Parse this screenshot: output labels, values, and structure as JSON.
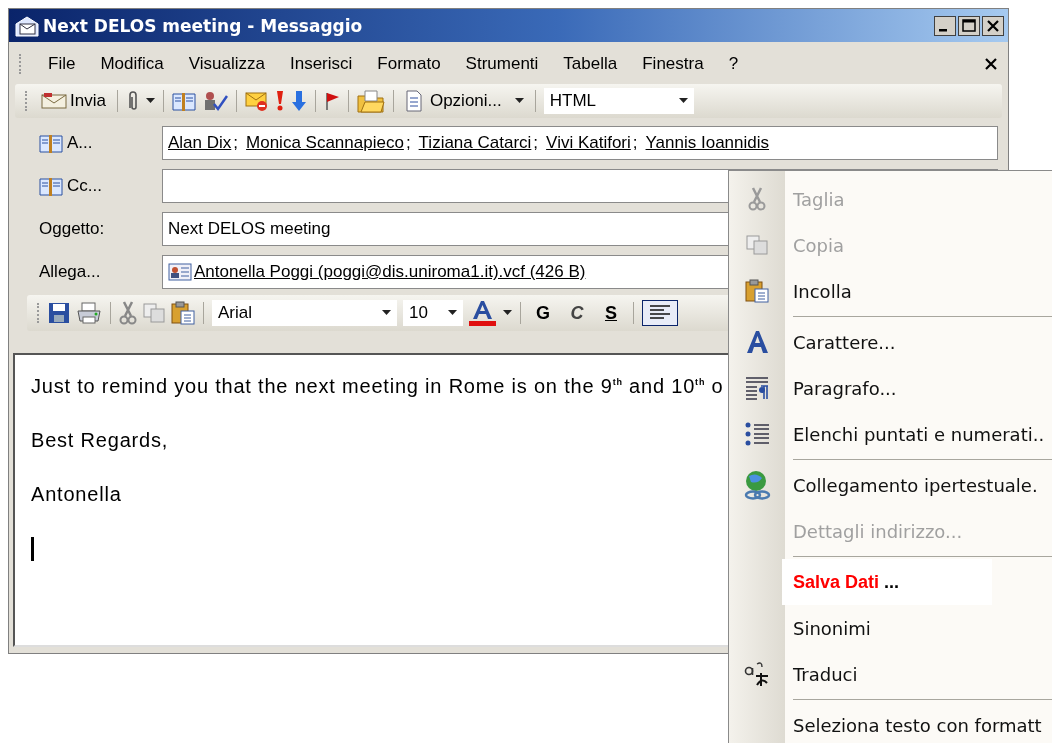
{
  "window": {
    "title": "Next DELOS meeting - Messaggio"
  },
  "menu_bar": [
    "File",
    "Modifica",
    "Visualizza",
    "Inserisci",
    "Formato",
    "Strumenti",
    "Tabella",
    "Finestra",
    "?"
  ],
  "toolbar": {
    "send": "Invia",
    "options": "Opzioni...",
    "format": "HTML"
  },
  "header_fields": [
    {
      "kind": "recipients",
      "label": "A...",
      "separator": ";",
      "recipients": [
        "Alan Dix",
        "Monica Scannapieco",
        "Tiziana Catarci",
        "Vivi Katifori",
        "Yannis Ioannidis"
      ]
    },
    {
      "kind": "address",
      "label": "Cc..."
    },
    {
      "kind": "text",
      "label": "Oggetto:",
      "value": "Next DELOS meeting"
    },
    {
      "kind": "attachment",
      "label": "Allega...",
      "value": "Antonella Poggi (poggi@dis.uniroma1.it).vcf (426 B)"
    }
  ],
  "format_toolbar": {
    "font": "Arial",
    "size": "10",
    "styles": [
      {
        "label": "G",
        "kind": "bold"
      },
      {
        "label": "C",
        "kind": "italic"
      },
      {
        "label": "S",
        "kind": "underline"
      }
    ],
    "align_left_pressed": true
  },
  "message": {
    "lines": [
      "Just to remind you that the next meeting in Rome is on the 9$^{th}$ and 10$^{th}$ o",
      "Best Regards,",
      "Antonella"
    ]
  },
  "context_menu": {
    "items": [
      {
        "kind": "cut",
        "label": "Taglia",
        "disabled": true
      },
      {
        "kind": "copy",
        "label": "Copia",
        "disabled": true
      },
      {
        "kind": "paste",
        "label": "Incolla",
        "disabled": false
      },
      {
        "kind": "separator"
      },
      {
        "kind": "font",
        "label": "Carattere...",
        "disabled": false
      },
      {
        "kind": "paragraph",
        "label": "Paragrafo...",
        "disabled": false
      },
      {
        "kind": "bullets",
        "label": "Elenchi puntati e numerati..",
        "disabled": false
      },
      {
        "kind": "separator"
      },
      {
        "kind": "hyperlink",
        "label": "Collegamento ipertestuale.",
        "disabled": false
      },
      {
        "kind": "plain",
        "label": "Dettagli indirizzo...",
        "disabled": true
      },
      {
        "kind": "separator"
      },
      {
        "kind": "highlight",
        "label": "Salva Dati",
        "suffix": "..."
      },
      {
        "kind": "plain",
        "label": "Sinonimi",
        "disabled": false
      },
      {
        "kind": "translate",
        "label": "Traduci",
        "disabled": false
      },
      {
        "kind": "separator"
      },
      {
        "kind": "plain",
        "label": "Seleziona testo con formatt",
        "disabled": false
      }
    ]
  }
}
